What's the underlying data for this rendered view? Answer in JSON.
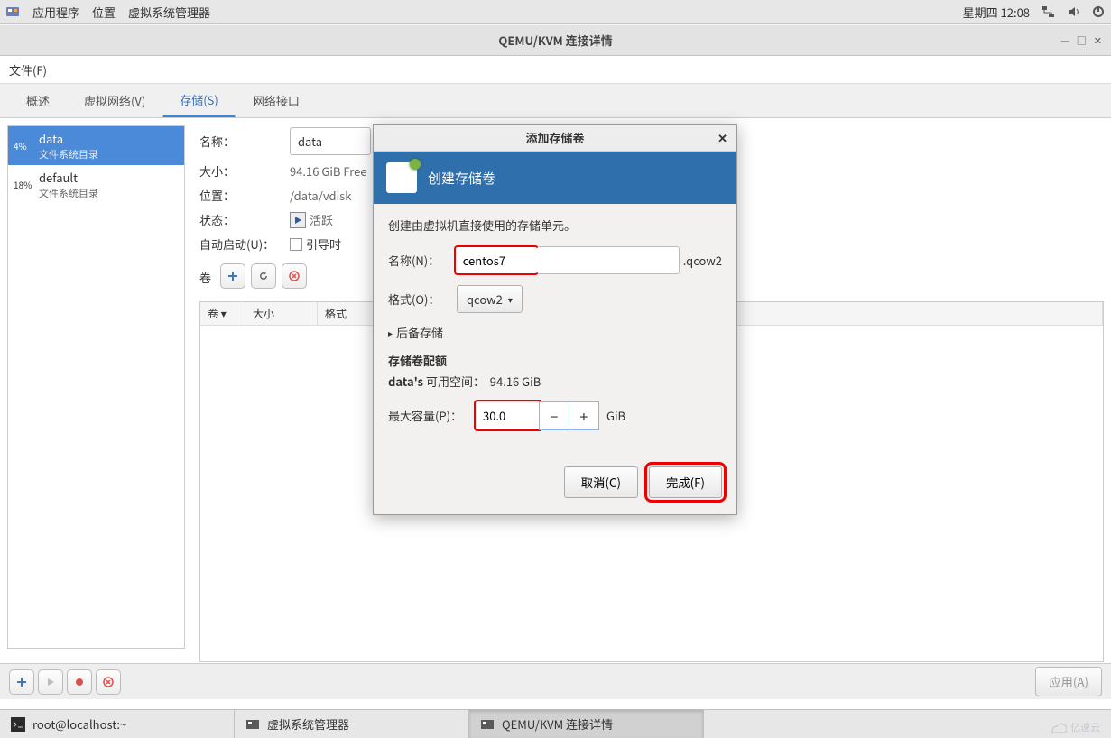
{
  "top_panel": {
    "app_menu": "应用程序",
    "places": "位置",
    "vmm": "虚拟系统管理器",
    "clock": "星期四 12:08"
  },
  "window": {
    "title": "QEMU/KVM 连接详情",
    "file_menu": "文件(F)"
  },
  "tabs": {
    "overview": "概述",
    "vnet": "虚拟网络(V)",
    "storage": "存储(S)",
    "iface": "网络接口"
  },
  "pools": [
    {
      "pct": "4%",
      "name": "data",
      "sub": "文件系统目录"
    },
    {
      "pct": "18%",
      "name": "default",
      "sub": "文件系统目录"
    }
  ],
  "detail": {
    "name_lbl": "名称：",
    "name_val": "data",
    "size_lbl": "大小：",
    "size_val": "94.16 GiB Free",
    "loc_lbl": "位置：",
    "loc_val": "/data/vdisk",
    "state_lbl": "状态：",
    "state_val": "活跃",
    "auto_lbl": "自动启动(U)：",
    "auto_val": "引导时",
    "vol_lbl": "卷"
  },
  "vol_headers": {
    "name": "卷",
    "size": "大小",
    "format": "格式"
  },
  "apply": "应用(A)",
  "modal": {
    "title": "添加存储卷",
    "header": "创建存储卷",
    "desc": "创建由虚拟机直接使用的存储单元。",
    "name_lbl": "名称(N)：",
    "name_val": "centos7",
    "ext": ".qcow2",
    "format_lbl": "格式(O)：",
    "format_val": "qcow2",
    "backing": "后备存储",
    "quota_h": "存储卷配额",
    "avail_prefix": "data's",
    "avail_label": "可用空间：",
    "avail_val": "94.16 GiB",
    "cap_lbl": "最大容量(P)：",
    "cap_val": "30.0",
    "unit": "GiB",
    "cancel": "取消(C)",
    "finish": "完成(F)"
  },
  "taskbar": {
    "t1": "root@localhost:~",
    "t2": "虚拟系统管理器",
    "t3": "QEMU/KVM 连接详情"
  },
  "watermark": "亿速云"
}
